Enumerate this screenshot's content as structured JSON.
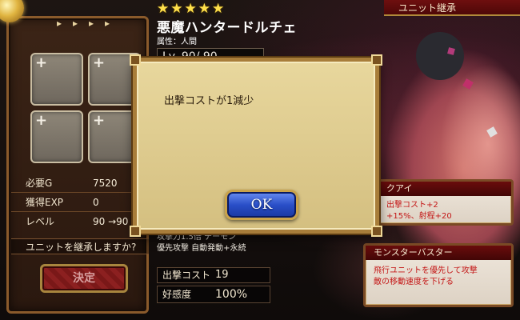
{
  "header": {
    "stars": [
      "★",
      "★",
      "★",
      "★",
      "★"
    ],
    "unit_name": "悪魔ハンタードルチェ",
    "attribute": "属性：人間",
    "level": "Lv. 90/ 90",
    "ribbon_title": "ユニット継承"
  },
  "left_panel": {
    "arrows": [
      "▸",
      "▸",
      "▸",
      "▸"
    ],
    "slot_plus": "+",
    "stats": [
      {
        "label": "必要G",
        "value": "7520"
      },
      {
        "label": "獲得EXP",
        "value": "0"
      },
      {
        "label": "レベル",
        "value": "90 →90"
      }
    ],
    "question": "ユニットを継承しますか?",
    "decide_label": "決定"
  },
  "middle": {
    "skill_line1": "攻撃力1.5倍 デーモン",
    "skill_line2": "優先攻撃 自動発動+永続",
    "cost_label": "出撃コスト",
    "cost_value": "19",
    "affinity_label": "好感度",
    "affinity_value": "100%"
  },
  "skills": [
    {
      "title": "クアイ",
      "lines": [
        "出撃コスト+2",
        "+15%、射程+20"
      ]
    },
    {
      "title": "モンスターバスター",
      "lines": [
        "飛行ユニットを優先して攻撃",
        "敵の移動速度を下げる"
      ]
    }
  ],
  "modal": {
    "message": "出撃コストが1減少",
    "ok_label": "OK"
  },
  "colors": {
    "accent_red": "#6a0c0c",
    "gold": "#a87d3a",
    "ok_blue": "#2a4fc8"
  }
}
